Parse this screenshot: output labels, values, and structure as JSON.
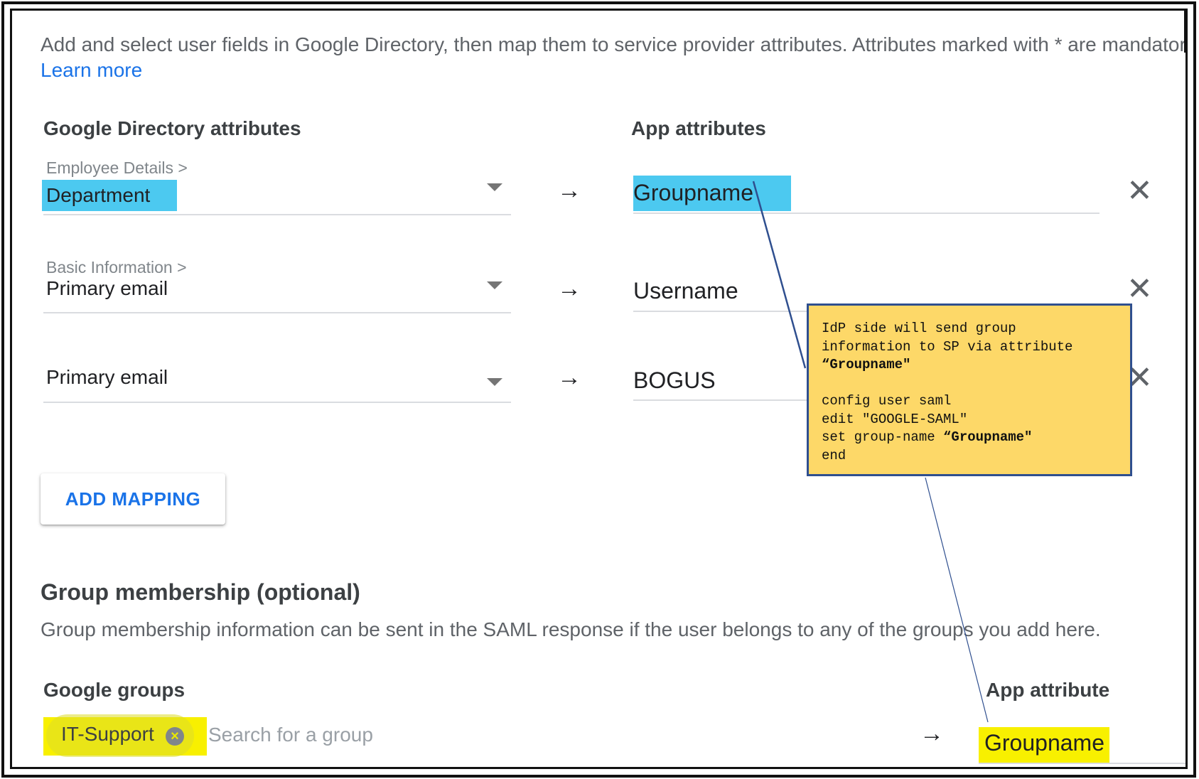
{
  "intro_text": "Add and select user fields in Google Directory, then map them to service provider attributes. Attributes marked with * are mandatory.",
  "learn_more": "Learn more",
  "headers": {
    "left": "Google Directory attributes",
    "right": "App attributes"
  },
  "mappings": [
    {
      "category": "Employee Details >",
      "value": "Department",
      "app_attr": "Groupname",
      "highlight": "#4cc9f0"
    },
    {
      "category": "Basic Information >",
      "value": "Primary email",
      "app_attr": "Username"
    },
    {
      "category": "",
      "value": "Primary email",
      "app_attr": "BOGUS"
    }
  ],
  "arrow_symbol": "→",
  "close_symbol": "✕",
  "add_mapping_label": "ADD MAPPING",
  "group_section": {
    "title": "Group membership (optional)",
    "description": "Group membership information can be sent in the SAML response if the user belongs to any of the groups you add here.",
    "groups_label": "Google groups",
    "app_attribute_label": "App attribute",
    "chip_label": "IT-Support",
    "search_placeholder": "Search for a group",
    "app_attribute_value": "Groupname",
    "highlight": "#f8f000"
  },
  "callout": {
    "line1": "IdP side will send group",
    "line2": "information to SP via attribute",
    "line3": "“Groupname\"",
    "line4": "config user saml",
    "line5": "edit \"GOOGLE-SAML\"",
    "line6_prefix": "set group-name ",
    "line6_bold": "“Groupname\"",
    "line7": "end",
    "bg_color": "#fdd868",
    "border_color": "#2f4f8f"
  }
}
